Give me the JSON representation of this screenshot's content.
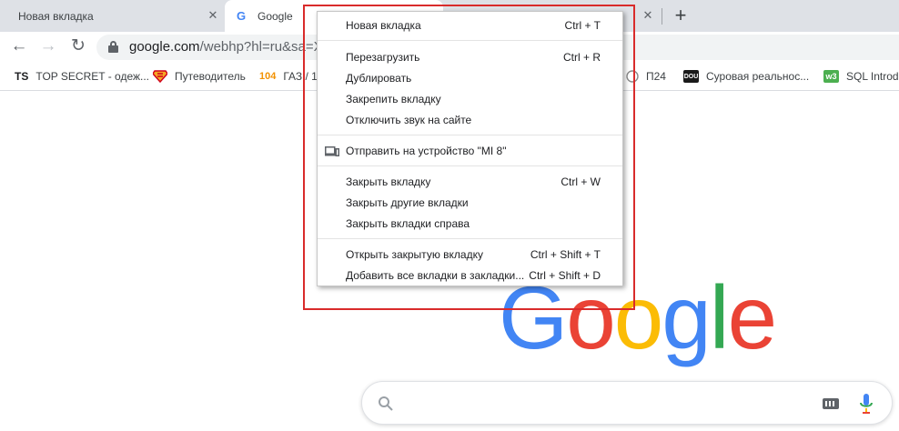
{
  "tabs": [
    {
      "label": "Новая вкладка"
    },
    {
      "label": "Google",
      "favicon": "google-g-icon"
    },
    {
      "label": ""
    }
  ],
  "toolbar": {
    "url_host": "google.com",
    "url_path": "/webhp?hl=ru&sa=X&",
    "icons": [
      "back-arrow-icon",
      "forward-arrow-icon",
      "reload-icon",
      "lock-icon"
    ]
  },
  "bookmarks": [
    {
      "icon_text": "TS",
      "label": "TOP SECRET - одеж..."
    },
    {
      "icon_text": "",
      "label": "Путеводитель"
    },
    {
      "icon_text": "104",
      "label": "ГАЗ / 1"
    },
    {
      "icon_text": "",
      "label": "П24"
    },
    {
      "icon_text": "DOU",
      "label": "Суровая реальнос..."
    },
    {
      "icon_text": "",
      "label": "SQL Introd"
    }
  ],
  "context_menu": {
    "groups": [
      [
        {
          "label": "Новая вкладка",
          "shortcut": "Ctrl + T"
        }
      ],
      [
        {
          "label": "Перезагрузить",
          "shortcut": "Ctrl + R"
        },
        {
          "label": "Дублировать",
          "shortcut": ""
        },
        {
          "label": "Закрепить вкладку",
          "shortcut": ""
        },
        {
          "label": "Отключить звук на сайте",
          "shortcut": ""
        }
      ],
      [
        {
          "label": "Отправить на устройство \"MI 8\"",
          "shortcut": "",
          "icon": "device-icon"
        }
      ],
      [
        {
          "label": "Закрыть вкладку",
          "shortcut": "Ctrl + W"
        },
        {
          "label": "Закрыть другие вкладки",
          "shortcut": ""
        },
        {
          "label": "Закрыть вкладки справа",
          "shortcut": ""
        }
      ],
      [
        {
          "label": "Открыть закрытую вкладку",
          "shortcut": "Ctrl + Shift + T"
        },
        {
          "label": "Добавить все вкладки в закладки...",
          "shortcut": "Ctrl + Shift + D"
        }
      ]
    ]
  },
  "google_logo": [
    "G",
    "o",
    "o",
    "g",
    "l",
    "e"
  ],
  "colors": {
    "highlight": "#d92b2b",
    "google_blue": "#4285f4",
    "google_red": "#ea4335",
    "google_yellow": "#fbbc05",
    "google_green": "#34a853"
  }
}
